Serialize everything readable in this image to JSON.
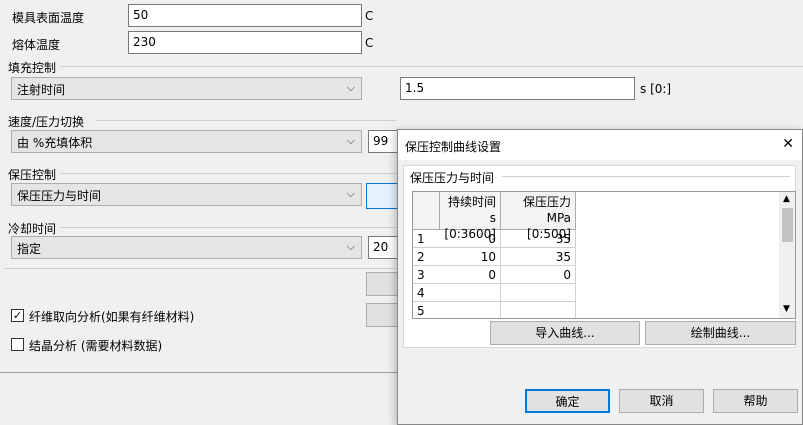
{
  "form": {
    "mold_temp_label": "模具表面温度",
    "mold_temp_value": "50",
    "mold_temp_unit": "C",
    "melt_temp_label": "熔体温度",
    "melt_temp_value": "230",
    "melt_temp_unit": "C",
    "fill_label": "填充控制",
    "fill_mode": "注射时间",
    "fill_value": "1.5",
    "fill_unit": "s [0:]",
    "switch_label": "速度/压力切换",
    "switch_mode": "由 %充填体积",
    "switch_value": "99",
    "pack_label": "保压控制",
    "pack_mode": "保压压力与时间",
    "cool_label": "冷却时间",
    "cool_mode": "指定",
    "cool_value": "20",
    "fiber_label": "纤维取向分析(如果有纤维材料)",
    "fiber_checked": "✓",
    "crystal_label": "结晶分析 (需要材料数据)"
  },
  "dialog": {
    "title": "保压控制曲线设置",
    "close": "✕",
    "group_title": "保压压力与时间",
    "col1_line1": "持续时间",
    "col1_line2": "s [0:3600]",
    "col2_line1": "保压压力",
    "col2_line2": "MPa [0:500]",
    "rows": [
      {
        "idx": "1",
        "duration": "0",
        "pressure": "35"
      },
      {
        "idx": "2",
        "duration": "10",
        "pressure": "35"
      },
      {
        "idx": "3",
        "duration": "0",
        "pressure": "0"
      },
      {
        "idx": "4",
        "duration": "",
        "pressure": ""
      },
      {
        "idx": "5",
        "duration": "",
        "pressure": ""
      }
    ],
    "import_btn": "导入曲线...",
    "plot_btn": "绘制曲线...",
    "ok_btn": "确定",
    "cancel_btn": "取消",
    "help_btn": "帮助"
  }
}
